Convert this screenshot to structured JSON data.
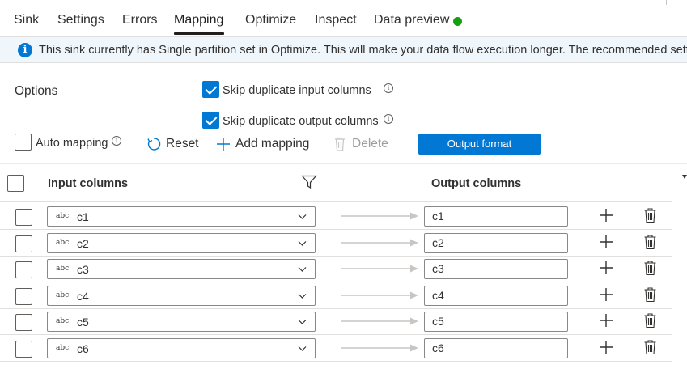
{
  "tabs": [
    {
      "label": "Sink"
    },
    {
      "label": "Settings"
    },
    {
      "label": "Errors"
    },
    {
      "label": "Mapping"
    },
    {
      "label": "Optimize"
    },
    {
      "label": "Inspect"
    },
    {
      "label": "Data preview"
    }
  ],
  "active_tab": "Mapping",
  "status_color": "#13a10e",
  "banner": {
    "icon": "info-icon",
    "text": "This sink currently has Single partition set in Optimize. This will make your data flow execution longer. The recommended setting is"
  },
  "options": {
    "label": "Options",
    "skip_input": {
      "label": "Skip duplicate input columns",
      "checked": true
    },
    "skip_output": {
      "label": "Skip duplicate output columns",
      "checked": true
    }
  },
  "toolbar": {
    "auto_mapping": {
      "label": "Auto mapping",
      "checked": false
    },
    "reset_label": "Reset",
    "add_label": "Add mapping",
    "delete_label": "Delete",
    "output_format_label": "Output format"
  },
  "table": {
    "input_header": "Input columns",
    "output_header": "Output columns",
    "rows": [
      {
        "type": "abc",
        "input": "c1",
        "output": "c1"
      },
      {
        "type": "abc",
        "input": "c2",
        "output": "c2"
      },
      {
        "type": "abc",
        "input": "c3",
        "output": "c3"
      },
      {
        "type": "abc",
        "input": "c4",
        "output": "c4"
      },
      {
        "type": "abc",
        "input": "c5",
        "output": "c5"
      },
      {
        "type": "abc",
        "input": "c6",
        "output": "c6"
      }
    ]
  },
  "colors": {
    "accent": "#0078d4",
    "banner_bg": "#eff6fc"
  }
}
